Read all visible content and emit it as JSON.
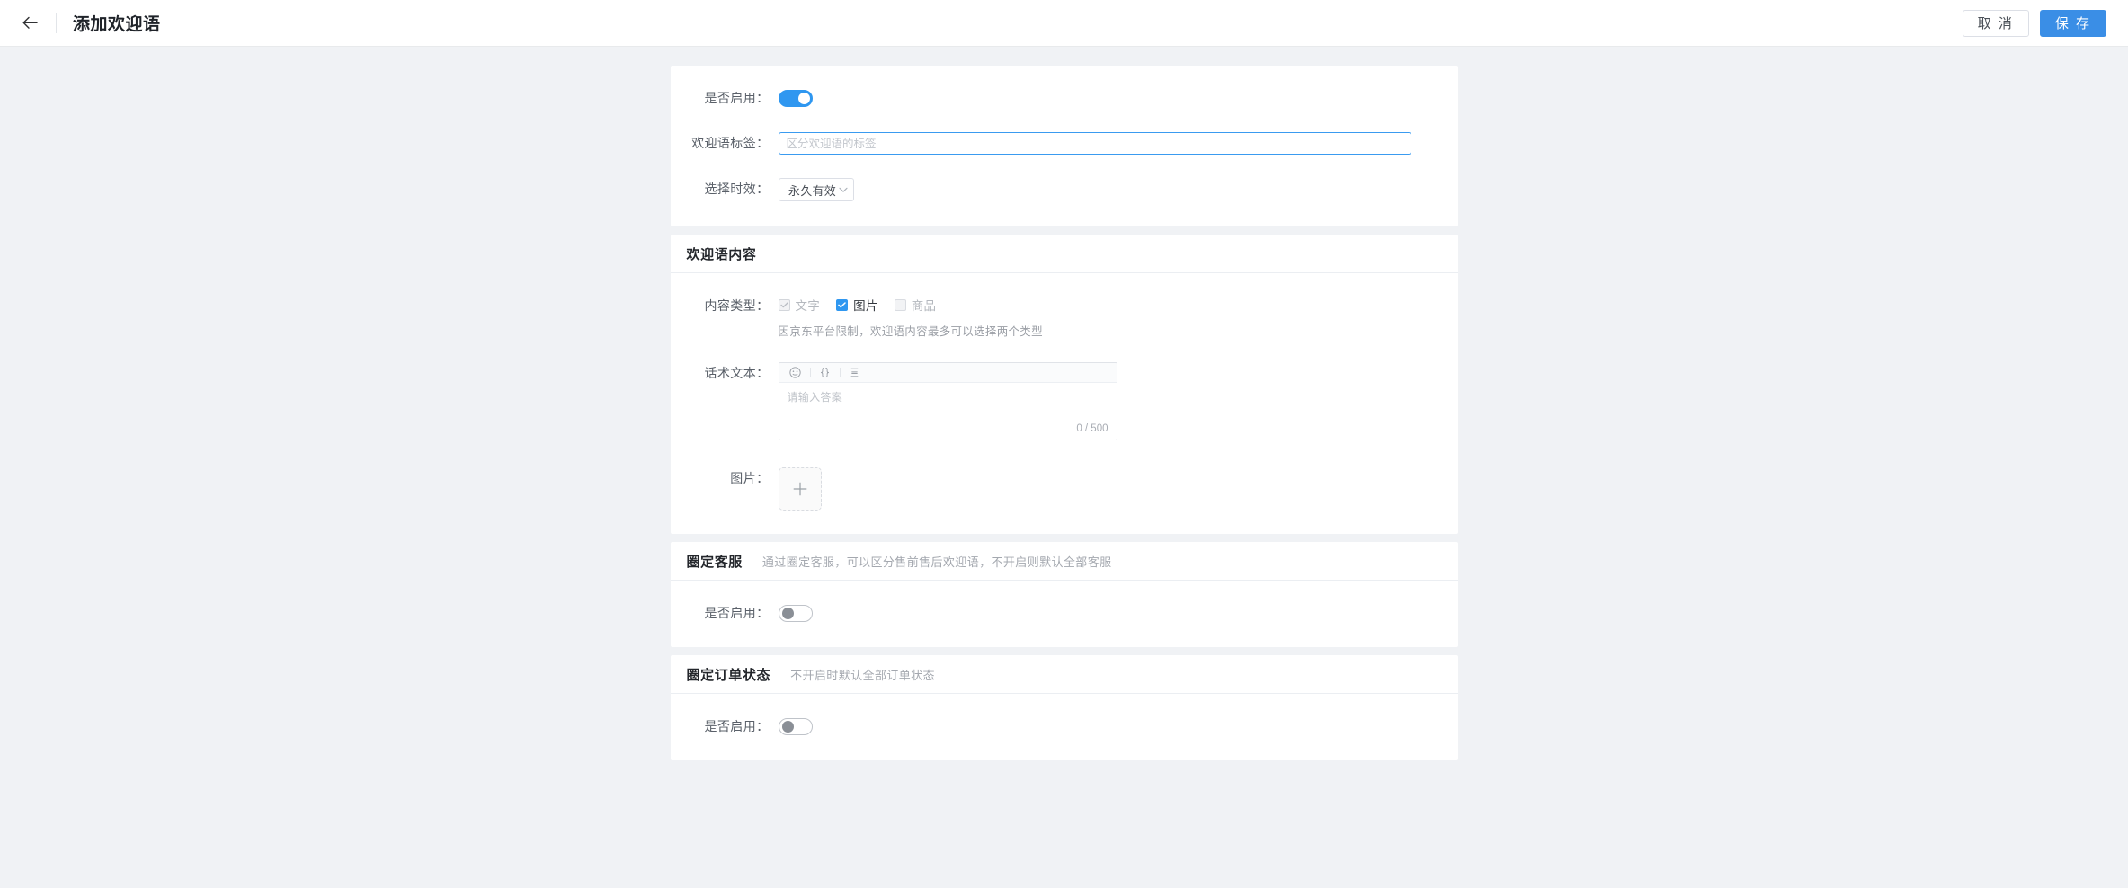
{
  "header": {
    "back_icon": "arrow-left-icon",
    "title": "添加欢迎语",
    "cancel_label": "取 消",
    "save_label": "保 存",
    "accent_color": "#3a8ee6"
  },
  "basic": {
    "enable_label": "是否启用：",
    "enable_state": "on",
    "tag_label": "欢迎语标签：",
    "tag_value": "",
    "tag_placeholder": "区分欢迎语的标签",
    "validity_label": "选择时效：",
    "validity_value": "永久有效",
    "validity_arrow_icon": "chevron-down-icon"
  },
  "content": {
    "section_title": "欢迎语内容",
    "type_label": "内容类型：",
    "types": [
      {
        "label": "文字",
        "checked": true,
        "disabled": true
      },
      {
        "label": "图片",
        "checked": true,
        "disabled": false
      },
      {
        "label": "商品",
        "checked": false,
        "disabled": true
      }
    ],
    "type_hint": "因京东平台限制，欢迎语内容最多可以选择两个类型",
    "text_label": "话术文本：",
    "toolbar": [
      {
        "icon": "emoji-icon"
      },
      {
        "icon": "variable-braces-icon"
      },
      {
        "icon": "quick-reply-icon"
      }
    ],
    "text_value": "",
    "text_placeholder": "请输入答案",
    "counter": "0 / 500",
    "image_label": "图片：",
    "upload_icon": "plus-icon"
  },
  "agents": {
    "section_title": "圈定客服",
    "section_desc": "通过圈定客服，可以区分售前售后欢迎语，不开启则默认全部客服",
    "enable_label": "是否启用：",
    "enable_state": "off"
  },
  "order_status": {
    "section_title": "圈定订单状态",
    "section_desc": "不开启时默认全部订单状态",
    "enable_label": "是否启用：",
    "enable_state": "off"
  }
}
